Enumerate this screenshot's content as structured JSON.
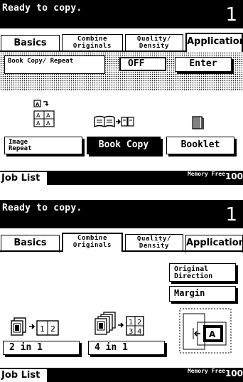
{
  "screens": [
    {
      "status": {
        "text": "Ready to copy.",
        "count": "1"
      },
      "tabs": [
        {
          "label": "Basics"
        },
        {
          "label_line1": "Combine",
          "label_line2": "Originals"
        },
        {
          "label_line1": "Quality/",
          "label_line2": "Density"
        },
        {
          "label": "Application"
        }
      ],
      "active_tab": "Application",
      "book_copy_section": {
        "label_line1": "Book Copy/",
        "label_line2": "Repeat",
        "value": "OFF",
        "enter_label": "Enter"
      },
      "options": [
        {
          "label_line1": "Image",
          "label_line2": "Repeat",
          "icon": "image-repeat-icon"
        },
        {
          "label": "Book Copy",
          "icon": "book-copy-icon",
          "selected": true
        },
        {
          "label": "Booklet",
          "icon": "booklet-icon"
        }
      ],
      "footer": {
        "job_list": "Job List",
        "memory_line1": "Memory",
        "memory_line2": "Free",
        "memory_value": "100"
      }
    },
    {
      "status": {
        "text": "Ready to copy.",
        "count": "1"
      },
      "tabs": [
        {
          "label": "Basics"
        },
        {
          "label_line1": "Combine",
          "label_line2": "Originals"
        },
        {
          "label_line1": "Quality/",
          "label_line2": "Density"
        },
        {
          "label": "Application"
        }
      ],
      "active_tab": "Combine Originals",
      "side_buttons": [
        {
          "label_line1": "Original",
          "label_line2": "Direction"
        },
        {
          "label": "Margin"
        }
      ],
      "options": [
        {
          "label": "2 in 1",
          "icon": "two-in-one-icon"
        },
        {
          "label": "4 in 1",
          "icon": "four-in-one-icon"
        }
      ],
      "footer": {
        "job_list": "Job List",
        "memory_line1": "Memory",
        "memory_line2": "Free",
        "memory_value": "100"
      }
    }
  ],
  "colors": {
    "foreground": "#000000",
    "background": "#ffffff"
  }
}
